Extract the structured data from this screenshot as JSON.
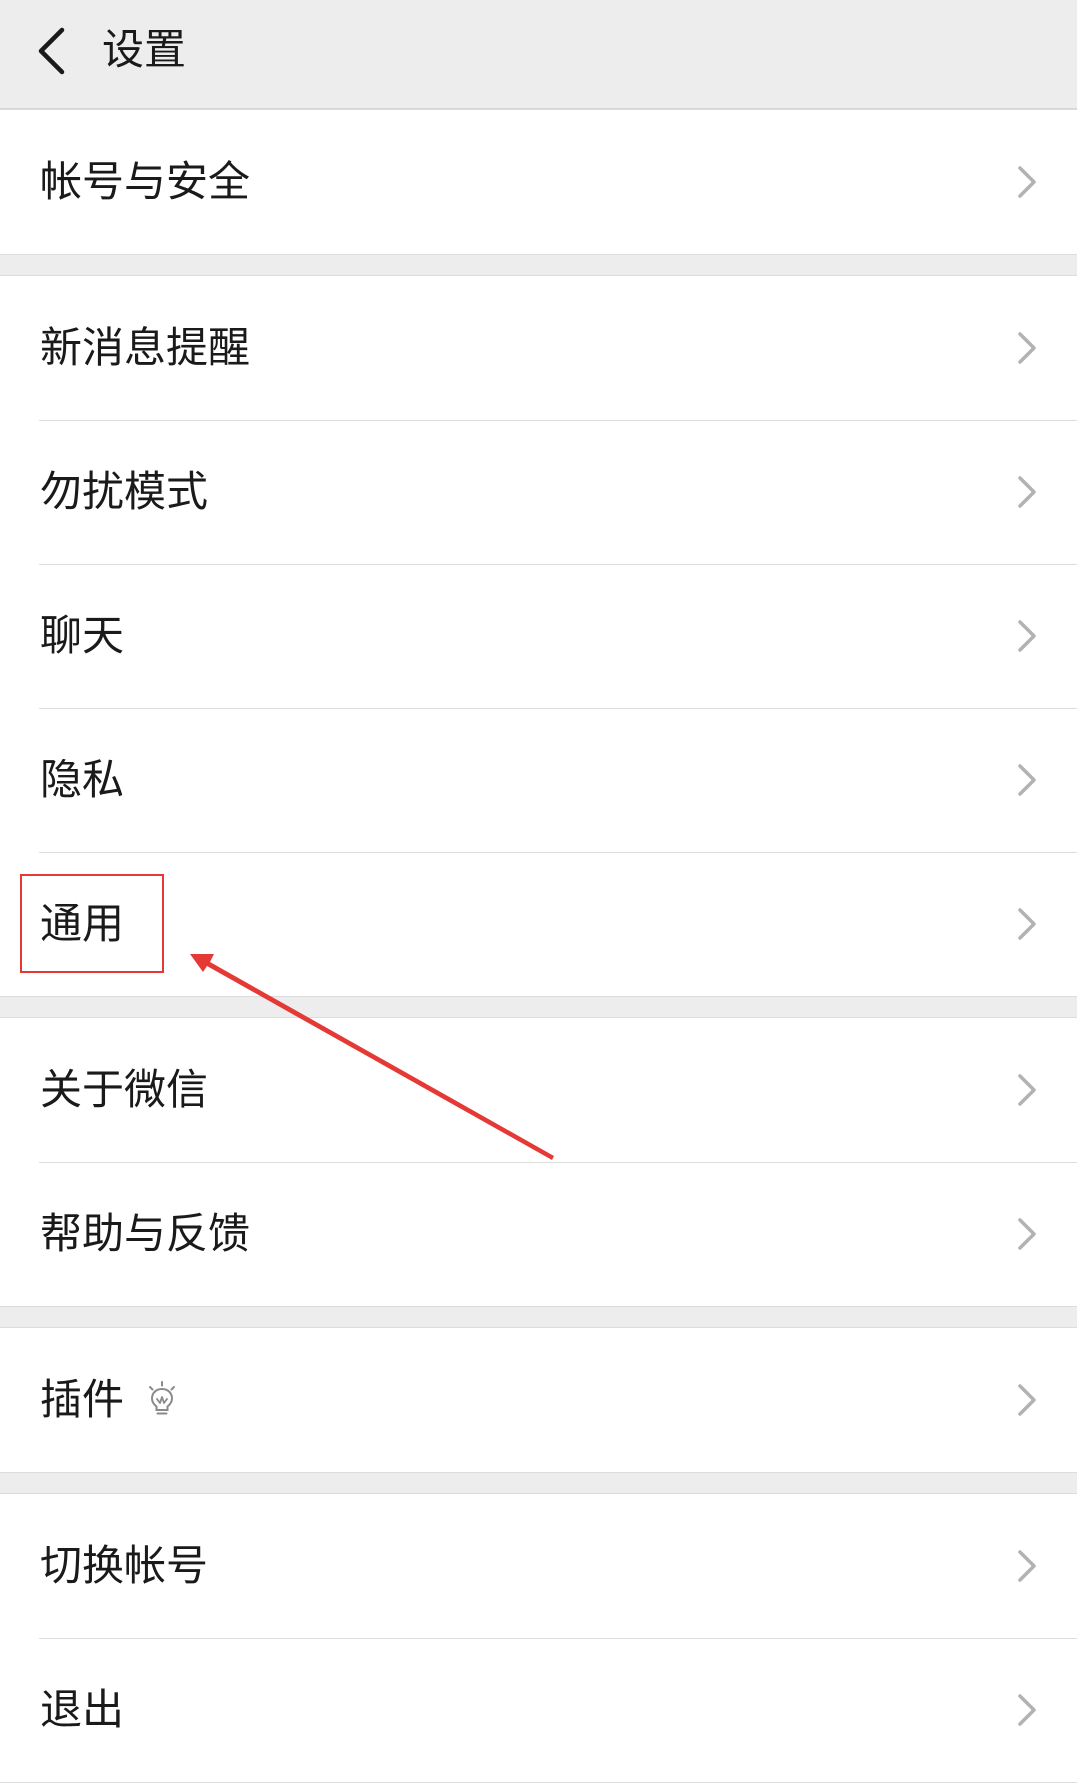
{
  "header": {
    "title": "设置",
    "back_icon": "chevron-left-icon"
  },
  "groups": [
    {
      "items": [
        {
          "label": "帐号与安全"
        }
      ]
    },
    {
      "items": [
        {
          "label": "新消息提醒"
        },
        {
          "label": "勿扰模式"
        },
        {
          "label": "聊天"
        },
        {
          "label": "隐私"
        },
        {
          "label": "通用"
        }
      ]
    },
    {
      "items": [
        {
          "label": "关于微信"
        },
        {
          "label": "帮助与反馈"
        }
      ]
    },
    {
      "items": [
        {
          "label": "插件",
          "badge_icon": "lightbulb-icon"
        }
      ]
    },
    {
      "items": [
        {
          "label": "切换帐号"
        },
        {
          "label": "退出"
        }
      ]
    }
  ],
  "annotation": {
    "highlight_target": "通用",
    "color": "#e53935"
  },
  "colors": {
    "background": "#ededed",
    "row_background": "#ffffff",
    "text": "#1a1a1a",
    "chevron": "#b2b2b2",
    "divider": "#dedede"
  }
}
